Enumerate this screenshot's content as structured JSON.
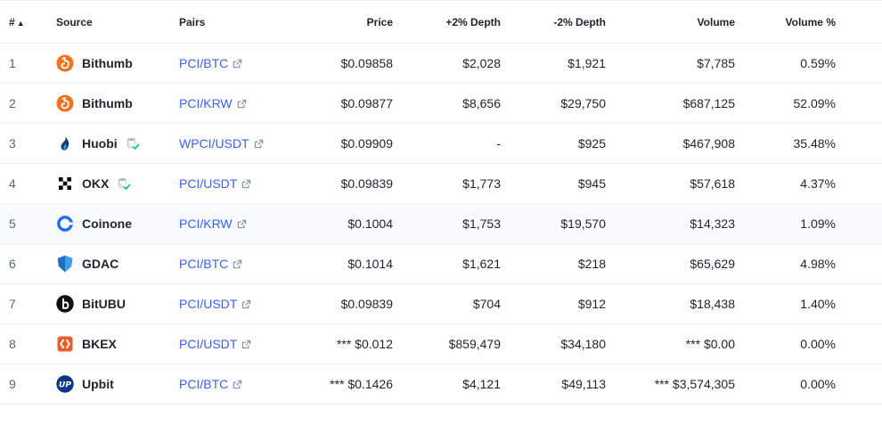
{
  "headers": {
    "rank": "#",
    "source": "Source",
    "pairs": "Pairs",
    "price": "Price",
    "plus_depth": "+2% Depth",
    "minus_depth": "-2% Depth",
    "volume": "Volume",
    "volume_pct": "Volume %"
  },
  "sort": {
    "column": "rank",
    "icon": "sort-ascending-icon"
  },
  "colors": {
    "link": "#3861fb",
    "text": "#222531",
    "muted": "#58667e",
    "verified": "#16c784"
  },
  "rows": [
    {
      "rank": "1",
      "exchange": "Bithumb",
      "logo": "bithumb-logo",
      "verified": false,
      "pair": "PCI/BTC",
      "price": "$0.09858",
      "plus_depth": "$2,028",
      "minus_depth": "$1,921",
      "volume": "$7,785",
      "volume_pct": "0.59%"
    },
    {
      "rank": "2",
      "exchange": "Bithumb",
      "logo": "bithumb-logo",
      "verified": false,
      "pair": "PCI/KRW",
      "price": "$0.09877",
      "plus_depth": "$8,656",
      "minus_depth": "$29,750",
      "volume": "$687,125",
      "volume_pct": "52.09%"
    },
    {
      "rank": "3",
      "exchange": "Huobi",
      "logo": "huobi-logo",
      "verified": true,
      "pair": "WPCI/USDT",
      "price": "$0.09909",
      "plus_depth": "-",
      "minus_depth": "$925",
      "volume": "$467,908",
      "volume_pct": "35.48%"
    },
    {
      "rank": "4",
      "exchange": "OKX",
      "logo": "okx-logo",
      "verified": true,
      "pair": "PCI/USDT",
      "price": "$0.09839",
      "plus_depth": "$1,773",
      "minus_depth": "$945",
      "volume": "$57,618",
      "volume_pct": "4.37%"
    },
    {
      "rank": "5",
      "exchange": "Coinone",
      "logo": "coinone-logo",
      "verified": false,
      "pair": "PCI/KRW",
      "price": "$0.1004",
      "plus_depth": "$1,753",
      "minus_depth": "$19,570",
      "volume": "$14,323",
      "volume_pct": "1.09%"
    },
    {
      "rank": "6",
      "exchange": "GDAC",
      "logo": "gdac-logo",
      "verified": false,
      "pair": "PCI/BTC",
      "price": "$0.1014",
      "plus_depth": "$1,621",
      "minus_depth": "$218",
      "volume": "$65,629",
      "volume_pct": "4.98%"
    },
    {
      "rank": "7",
      "exchange": "BitUBU",
      "logo": "bitubu-logo",
      "verified": false,
      "pair": "PCI/USDT",
      "price": "$0.09839",
      "plus_depth": "$704",
      "minus_depth": "$912",
      "volume": "$18,438",
      "volume_pct": "1.40%"
    },
    {
      "rank": "8",
      "exchange": "BKEX",
      "logo": "bkex-logo",
      "verified": false,
      "pair": "PCI/USDT",
      "price": "*** $0.012",
      "plus_depth": "$859,479",
      "minus_depth": "$34,180",
      "volume": "*** $0.00",
      "volume_pct": "0.00%"
    },
    {
      "rank": "9",
      "exchange": "Upbit",
      "logo": "upbit-logo",
      "verified": false,
      "pair": "PCI/BTC",
      "price": "*** $0.1426",
      "plus_depth": "$4,121",
      "minus_depth": "$49,113",
      "volume": "*** $3,574,305",
      "volume_pct": "0.00%"
    }
  ]
}
